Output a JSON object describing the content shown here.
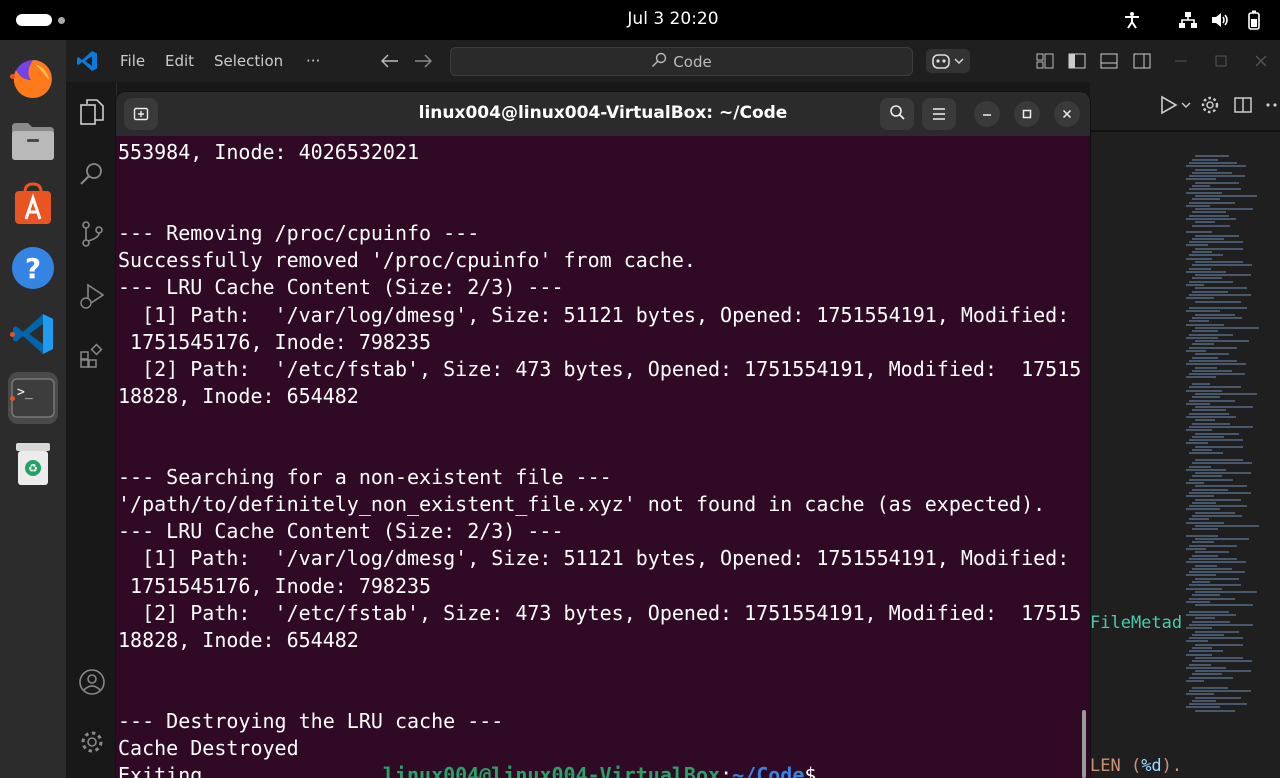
{
  "topbar": {
    "clock": "Jul 3  20:20"
  },
  "dock": {
    "apps": [
      "firefox-icon",
      "files-icon",
      "app-center-icon",
      "help-icon",
      "vscode-icon",
      "terminal-icon",
      "trash-icon"
    ]
  },
  "vscode": {
    "menu": {
      "file": "File",
      "edit": "Edit",
      "selection": "Selection",
      "more": "···"
    },
    "search_placeholder": "Code",
    "snippet_top": "FileMetad",
    "snippet_bottom_a": "LEN (",
    "snippet_bottom_b": "%d",
    "snippet_bottom_c": ").",
    "colors": {
      "accent": "#007acc",
      "background": "#181818"
    }
  },
  "terminal": {
    "title": "linux004@linux004-VirtualBox: ~/Code",
    "lines": [
      "553984, Inode: 4026532021",
      "",
      "",
      "--- Removing /proc/cpuinfo ---",
      "Successfully removed '/proc/cpuinfo' from cache.",
      "--- LRU Cache Content (Size: 2/3) ---",
      "  [1] Path:  '/var/log/dmesg', Size: 51121 bytes, Opened: 1751554191, Modified:",
      " 1751545176, Inode: 798235",
      "  [2] Path:  '/etc/fstab', Size: 473 bytes, Opened: 1751554191, Modified:  17515",
      "18828, Inode: 654482",
      "",
      "",
      "--- Searching for a non-existent file ---",
      "'/path/to/definitely_non_existent_file.xyz' not found in cache (as expected).",
      "--- LRU Cache Content (Size: 2/3) ---",
      "  [1] Path:  '/var/log/dmesg', Size: 51121 bytes, Opened: 1751554191, Modified:",
      " 1751545176, Inode: 798235",
      "  [2] Path:  '/etc/fstab', Size: 473 bytes, Opened: 1751554191, Modified:  17515",
      "18828, Inode: 654482",
      "",
      "",
      "--- Destroying the LRU cache ---",
      "Cache Destroyed"
    ],
    "last_line_text": "Exiting...............",
    "prompt_user": "linux004@linux004-VirtualBox",
    "prompt_colon": ":",
    "prompt_path": "~/Code",
    "prompt_symbol": "$",
    "colors": {
      "background": "#300a24",
      "prompt_user": "#26a269",
      "prompt_path": "#3584e4"
    }
  }
}
